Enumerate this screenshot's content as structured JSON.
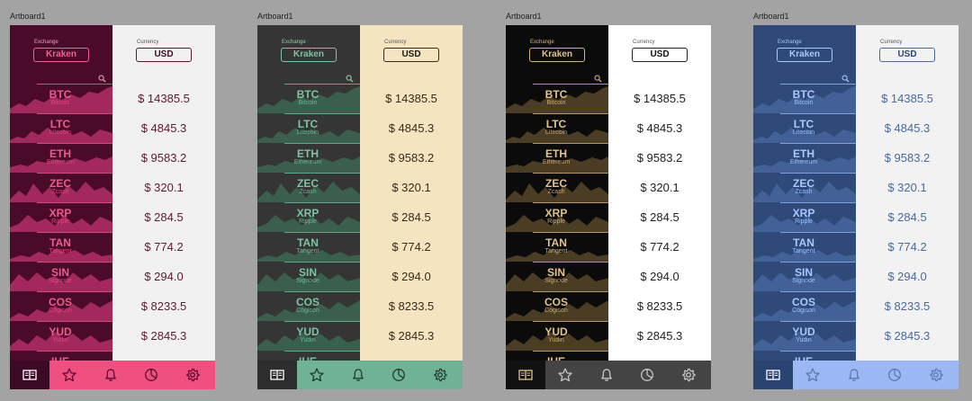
{
  "artboard_title": "Artboard1",
  "exchange_label": "Exchange",
  "exchange_value": "Kraken",
  "currency_label": "Currency",
  "currency_value": "USD",
  "coins": [
    {
      "symbol": "BTC",
      "name": "Bitcoin",
      "price": "$ 14385.5"
    },
    {
      "symbol": "LTC",
      "name": "Litecoin",
      "price": "$ 4845.3"
    },
    {
      "symbol": "ETH",
      "name": "Ethereum",
      "price": "$ 9583.2"
    },
    {
      "symbol": "ZEC",
      "name": "Zcash",
      "price": "$ 320.1"
    },
    {
      "symbol": "XRP",
      "name": "Ripple",
      "price": "$ 284.5"
    },
    {
      "symbol": "TAN",
      "name": "Tangent",
      "price": "$ 774.2"
    },
    {
      "symbol": "SIN",
      "name": "Signode",
      "price": "$ 294.0"
    },
    {
      "symbol": "COS",
      "name": "Cogison",
      "price": "$ 8233.5"
    },
    {
      "symbol": "YUD",
      "name": "Yudin",
      "price": "$ 2845.3"
    },
    {
      "symbol": "IHE",
      "name": "",
      "price": ""
    }
  ],
  "tab_icons": [
    "book-icon",
    "star-icon",
    "bell-icon",
    "pie-chart-icon",
    "gear-icon"
  ],
  "themes": [
    {
      "name": "crimson",
      "left_bg": "#4a0a2a",
      "right_bg": "#f1f1f1",
      "accent": "#e8457d",
      "text": "#ee5c8d",
      "sub": "#e8457d",
      "price": "#5a1a32",
      "sep": "#d44a7e",
      "tab_left_bg": "#3c0a24",
      "tab_right_bg": "#f0507f",
      "tab_left_icon": "#ffffff",
      "tab_right_icon": "#5a0a2e",
      "label": "#f0a0c0",
      "label_r": "#555555",
      "pill_border": "#f06090",
      "pill_text": "#f06090",
      "pill_r_border": "#5a1a32",
      "pill_r_text": "#3a0a20",
      "spark": "#b8306a"
    },
    {
      "name": "jade",
      "left_bg": "#353535",
      "right_bg": "#f4e4c0",
      "accent": "#6bb595",
      "text": "#7cc4a4",
      "sub": "#6bb595",
      "price": "#3a2a1a",
      "sep": "#5fa888",
      "tab_left_bg": "#2d2d2d",
      "tab_right_bg": "#6fb295",
      "tab_left_icon": "#ffffff",
      "tab_right_icon": "#1d3d30",
      "label": "#8fd0b0",
      "label_r": "#555555",
      "pill_border": "#7cc4a4",
      "pill_text": "#7cc4a4",
      "pill_r_border": "#3a2a1a",
      "pill_r_text": "#1a1a1a",
      "spark": "#3c6a55"
    },
    {
      "name": "gold",
      "left_bg": "#0b0b0b",
      "right_bg": "#ffffff",
      "accent": "#d4b77c",
      "text": "#e0c58a",
      "sub": "#c8ab70",
      "price": "#222222",
      "sep": "#b89a60",
      "tab_left_bg": "#111111",
      "tab_right_bg": "#444444",
      "tab_left_icon": "#e0c58a",
      "tab_right_icon": "#c8c8c8",
      "label": "#d4b77c",
      "label_r": "#555555",
      "pill_border": "#d4b77c",
      "pill_text": "#e0c58a",
      "pill_r_border": "#222222",
      "pill_r_text": "#111111",
      "spark": "#5a4a2a"
    },
    {
      "name": "navy",
      "left_bg": "#2f4a78",
      "right_bg": "#f2f2f2",
      "accent": "#9cc0ff",
      "text": "#a8c8ff",
      "sub": "#9cc0ff",
      "price": "#4a6a9a",
      "sep": "#7fa2dd",
      "tab_left_bg": "#2a4472",
      "tab_right_bg": "#9cb8f4",
      "tab_left_icon": "#ffffff",
      "tab_right_icon": "#5a78b0",
      "label": "#a8c8ff",
      "label_r": "#555555",
      "pill_border": "#a8c8ff",
      "pill_text": "#a8c8ff",
      "pill_r_border": "#4a6a9a",
      "pill_r_text": "#2a4472",
      "spark": "#46679f"
    }
  ]
}
